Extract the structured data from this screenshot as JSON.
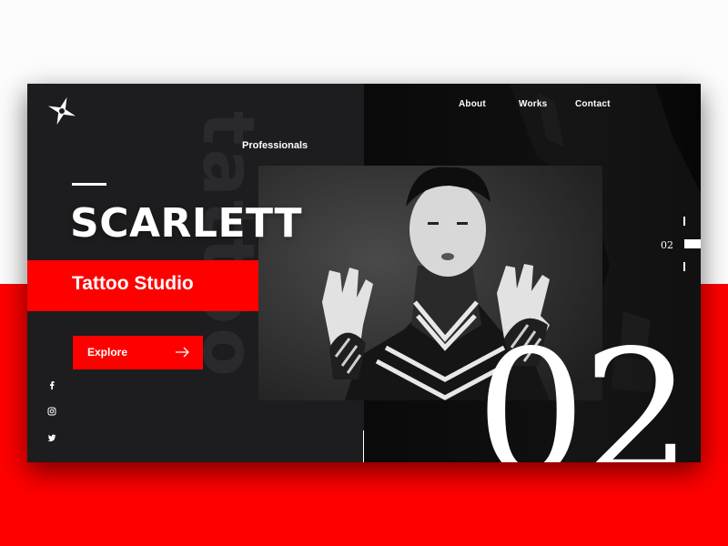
{
  "colors": {
    "accent": "#ff0000",
    "card_dark": "#1d1d1f",
    "card_darker": "#0a0a0a",
    "text": "#ffffff",
    "background_light": "#fcfcfd"
  },
  "logo": {
    "icon": "compass-star-icon"
  },
  "nav": {
    "items": [
      {
        "label": "About"
      },
      {
        "label": "Works"
      },
      {
        "label": "Contact"
      }
    ]
  },
  "background_word": "tattoo",
  "hero": {
    "eyebrow": "Professionals",
    "title": "SCARLETT",
    "subtitle": "Tattoo Studio",
    "cta_label": "Explore",
    "cta_icon": "arrow-right-icon"
  },
  "social": [
    {
      "icon": "facebook-icon"
    },
    {
      "icon": "instagram-icon"
    },
    {
      "icon": "twitter-icon"
    }
  ],
  "slider": {
    "current": "02",
    "large_number": "02."
  },
  "photo": {
    "subject": "portrait-photo"
  }
}
